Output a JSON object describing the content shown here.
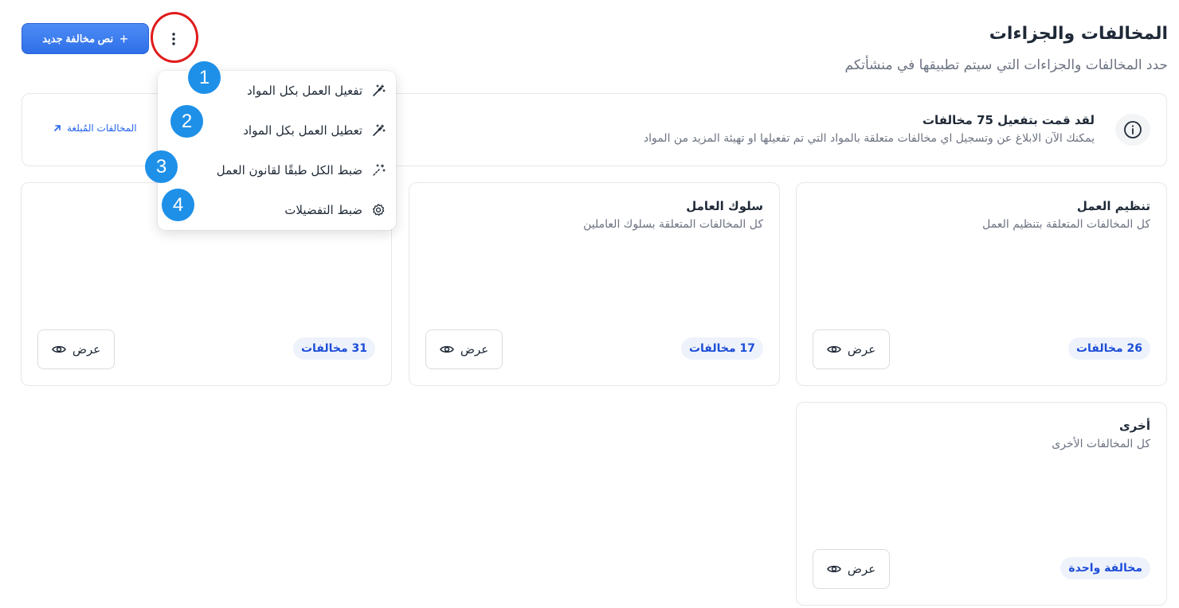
{
  "header": {
    "title": "المخالفات والجزاءات",
    "subtitle": "حدد المخالفات والجزاءات التي سيتم تطبيقها في منشأتكم",
    "new_button": "نص مخالفة جديد"
  },
  "banner": {
    "title": "لقد قمت بتفعيل 75 مخالفات",
    "text": "يمكنك الآن الابلاغ عن وتسجيل اي مخالفات متعلقة بالمواد التي تم تفعيلها او تهيئة المزيد من المواد",
    "link": "المخالفات المُبلغة"
  },
  "dropdown": {
    "items": [
      {
        "label": "تفعيل العمل بكل المواد",
        "icon": "magic-wand-icon"
      },
      {
        "label": "تعطيل العمل بكل المواد",
        "icon": "magic-wand-icon"
      },
      {
        "label": "ضبط الكل طبقًا لقانون العمل",
        "icon": "sparkle-wand-icon"
      },
      {
        "label": "ضبط التفضيلات",
        "icon": "gear-icon"
      }
    ]
  },
  "steps": [
    "1",
    "2",
    "3",
    "4"
  ],
  "cards": [
    {
      "title": "تنظيم العمل",
      "desc": "كل المخالفات المتعلقة بتنظيم العمل",
      "count": "26 مخالفات",
      "view": "عرض"
    },
    {
      "title": "سلوك العامل",
      "desc": "كل المخالفات المتعلقة بسلوك العاملين",
      "count": "17 مخالفات",
      "view": "عرض"
    },
    {
      "title": "",
      "desc": "",
      "count": "31 مخالفات",
      "view": "عرض"
    },
    {
      "title": "أخرى",
      "desc": "كل المخالفات الأخرى",
      "count": "مخالفة واحدة",
      "view": "عرض"
    }
  ],
  "colors": {
    "primary": "#2f6fe8",
    "badge_bg": "#eef2fb",
    "badge_text": "#1d4ed8",
    "step_circle": "#1e90e8",
    "highlight_ring": "#e01b1b"
  }
}
